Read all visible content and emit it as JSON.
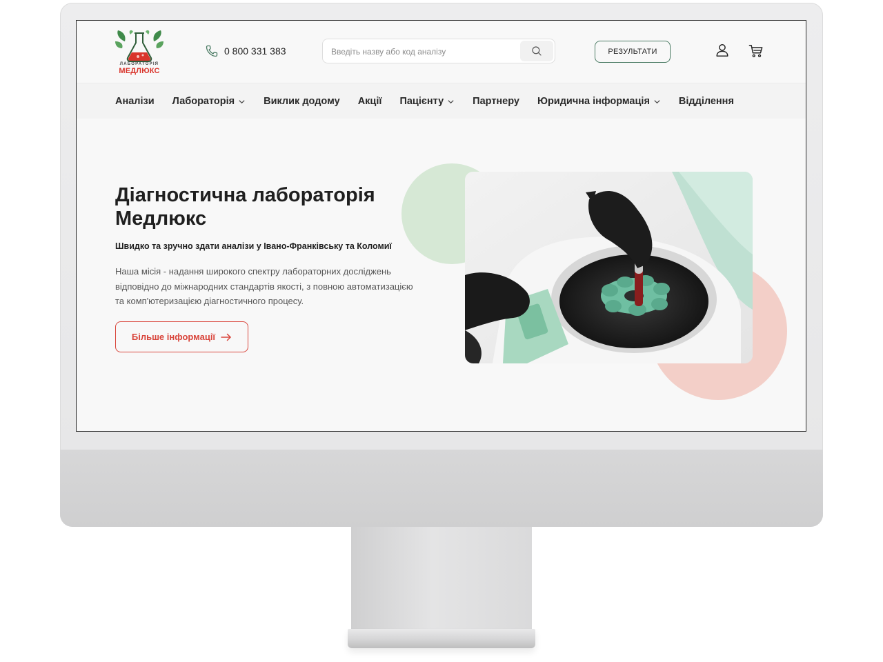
{
  "header": {
    "logo": {
      "text_top": "ЛАБОРАТОРІЯ",
      "text_main": "МЕДЛЮКС",
      "icon": "flask-leaves-logo"
    },
    "phone": {
      "number": "0 800 331 383",
      "icon": "phone-icon"
    },
    "search": {
      "placeholder": "Введіть назву або код аналізу",
      "value": "",
      "icon": "search-icon"
    },
    "results_label": "РЕЗУЛЬТАТИ",
    "user_icon": "user-icon",
    "cart_icon": "cart-icon"
  },
  "nav": {
    "items": [
      {
        "label": "Аналізи",
        "dropdown": false
      },
      {
        "label": "Лабораторія",
        "dropdown": true
      },
      {
        "label": "Виклик додому",
        "dropdown": false
      },
      {
        "label": "Акції",
        "dropdown": false
      },
      {
        "label": "Пацієнту",
        "dropdown": true
      },
      {
        "label": "Партнеру",
        "dropdown": false
      },
      {
        "label": "Юридична інформація",
        "dropdown": true
      },
      {
        "label": "Відділення",
        "dropdown": false
      }
    ]
  },
  "hero": {
    "title_lines": [
      "Діагностична лабораторія",
      "Медлюкс"
    ],
    "subtitle": "Швидко та зручно здати аналізи у Івано-Франківську та Коломиї",
    "description_lines": [
      "Наша місія - надання широкого спектру лабораторних досліджень",
      "відповідно до міжнародних стандартів якості, з повною автоматизацією",
      "та комп'ютеризацією діагностичного процесу."
    ],
    "button_label": "Більше інформації",
    "button_icon": "arrow-right-icon",
    "image": "centrifuge-lab-photo"
  },
  "colors": {
    "brand_red": "#d9463c",
    "brand_green": "#4a7a63",
    "circle_green": "#d6e8d5",
    "circle_pink": "#f3cfc8"
  }
}
